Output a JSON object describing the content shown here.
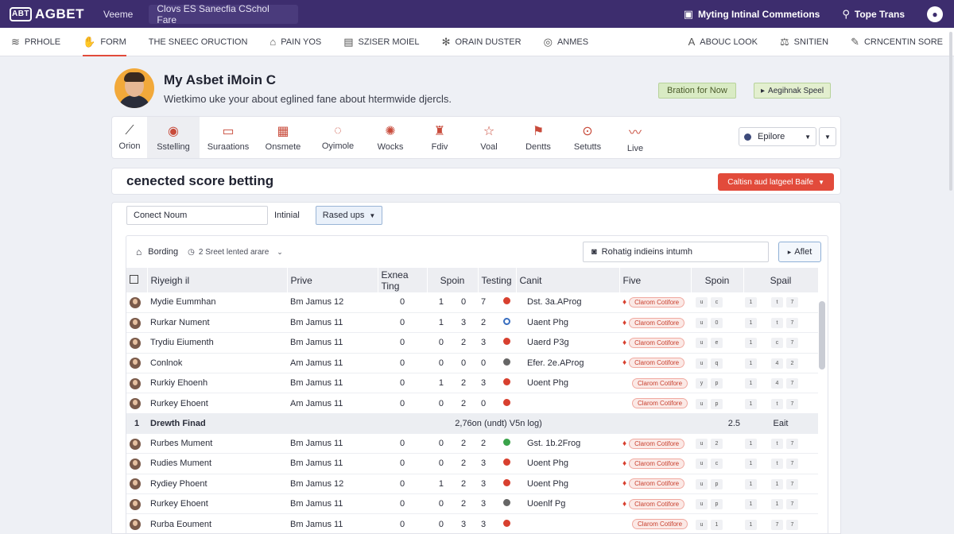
{
  "topbar": {
    "logo": "AGBET",
    "logo_badge": "ABT",
    "link": "Veeme",
    "search_text": "Clovs ES Sanecfia CSchol Fare",
    "action_label": "Myting Intinal Commetions",
    "user_label": "Tope Trans"
  },
  "nav": {
    "items": [
      {
        "icon": "wifi-icon",
        "label": "PRHOLE"
      },
      {
        "icon": "hand-icon",
        "label": "FORM"
      },
      {
        "icon": "",
        "label": "THE SNEEC ORUCTION"
      },
      {
        "icon": "building-icon",
        "label": "PAIN YOS"
      },
      {
        "icon": "calendar-icon",
        "label": "SZISER MOIEL"
      },
      {
        "icon": "gear-icon",
        "label": "ORAIN DUSTER"
      },
      {
        "icon": "globe-icon",
        "label": "ANMES"
      }
    ],
    "right_items": [
      {
        "icon": "letter-a-icon",
        "label": "ABOUC LOOK"
      },
      {
        "icon": "scale-icon",
        "label": "SNITIEN"
      },
      {
        "icon": "pen-icon",
        "label": "CRNCENTIN SORE"
      }
    ]
  },
  "profile": {
    "name": "My Asbet iMoin C",
    "subtitle": "Wietkimo uke your about eglined fane about htermwide djercls.",
    "chip1": "Bration for Now",
    "chip2": "Aegihnak Speel"
  },
  "categories": {
    "items": [
      {
        "icon": "chart-icon",
        "label": "Orion"
      },
      {
        "icon": "target-icon",
        "label": "Sstelling"
      },
      {
        "icon": "ticket-icon",
        "label": "Suraations"
      },
      {
        "icon": "calendar-icon",
        "label": "Onsmete"
      },
      {
        "icon": "soccer-icon",
        "label": "Oyimole"
      },
      {
        "icon": "star-icon",
        "label": "Wocks"
      },
      {
        "icon": "trophy-icon",
        "label": "Fdiv"
      },
      {
        "icon": "star-outline-icon",
        "label": "Voal"
      },
      {
        "icon": "flag-icon",
        "label": "Dentts"
      },
      {
        "icon": "target-icon",
        "label": "Setutts"
      },
      {
        "icon": "wave-icon",
        "label": "Live"
      }
    ],
    "explore_label": "Epilore"
  },
  "section": {
    "title": "cenected score betting",
    "button_label": "Caltisn aud latgeel Baife"
  },
  "filters": {
    "input_value": "Conect Noum",
    "label": "Intinial",
    "select_value": "Rased ups"
  },
  "toolbar": {
    "label": "Bording",
    "info": "2 Sreet lented arare",
    "search_value": "Rohatig indieins intumh",
    "button_label": "Aflet"
  },
  "table": {
    "headers": [
      "",
      "Riyeigh il",
      "Prive",
      "Exnea Ting",
      "Spoin",
      "Testing",
      "Canit",
      "Five",
      "Spoin",
      "Spail"
    ],
    "pill_text": "Clarom Cotifore",
    "rows": [
      {
        "name": "Mydie Eummhan",
        "team": "Bm Jamus 12",
        "a": "0",
        "b": "1",
        "c": "0",
        "d": "7",
        "status": "red",
        "fire": true,
        "event": "Dst. 3a.AProg",
        "m": [
          "u",
          "c",
          "1",
          "t",
          "7"
        ]
      },
      {
        "name": "Rurkar Nument",
        "team": "Bm Jamus 11",
        "a": "0",
        "b": "1",
        "c": "3",
        "d": "2",
        "status": "ring",
        "fire": true,
        "event": "Uaent Phg",
        "m": [
          "u",
          "0",
          "1",
          "t",
          "7"
        ]
      },
      {
        "name": "Trydiu Eiumenth",
        "team": "Bm Jamus 11",
        "a": "0",
        "b": "0",
        "c": "2",
        "d": "3",
        "status": "red",
        "fire": true,
        "event": "Uaerd P3g",
        "m": [
          "u",
          "e",
          "1",
          "c",
          "7"
        ]
      },
      {
        "name": "Conlnok",
        "team": "Am Jamus 11",
        "a": "0",
        "b": "0",
        "c": "0",
        "d": "0",
        "status": "gray",
        "fire": true,
        "event": "Efer. 2e.AProg",
        "m": [
          "u",
          "q",
          "1",
          "4",
          "2"
        ]
      },
      {
        "name": "Rurkiy Ehoenh",
        "team": "Bm Jamus 11",
        "a": "0",
        "b": "1",
        "c": "2",
        "d": "3",
        "status": "red",
        "fire": false,
        "event": "Uoent Phg",
        "m": [
          "y",
          "p",
          "1",
          "4",
          "7"
        ]
      },
      {
        "name": "Rurkey Ehoent",
        "team": "Am Jamus 11",
        "a": "0",
        "b": "0",
        "c": "2",
        "d": "0",
        "status": "red",
        "fire": false,
        "event": "",
        "m": [
          "u",
          "p",
          "1",
          "t",
          "7"
        ]
      }
    ],
    "group": {
      "index": "1",
      "label": "Drewth Finad",
      "summary": "2,76on (undt) V5n log)",
      "value": "2.5",
      "extra": "Eait"
    },
    "rows2": [
      {
        "name": "Rurbes Mument",
        "team": "Bm Jamus 11",
        "a": "0",
        "b": "0",
        "c": "2",
        "d": "2",
        "status": "green",
        "fire": true,
        "event": "Gst. 1b.2Frog",
        "m": [
          "u",
          "2",
          "1",
          "t",
          "7"
        ]
      },
      {
        "name": "Rudies Mument",
        "team": "Bm Jamus 11",
        "a": "0",
        "b": "0",
        "c": "2",
        "d": "3",
        "status": "red",
        "fire": true,
        "event": "Uoent Phg",
        "m": [
          "u",
          "c",
          "1",
          "t",
          "7"
        ]
      },
      {
        "name": "Rydiey Phoent",
        "team": "Bm Jamus 12",
        "a": "0",
        "b": "1",
        "c": "2",
        "d": "3",
        "status": "red",
        "fire": true,
        "event": "Uoent Phg",
        "m": [
          "u",
          "p",
          "1",
          "1",
          "7"
        ]
      },
      {
        "name": "Rurkey Ehoent",
        "team": "Bm Jamus 11",
        "a": "0",
        "b": "0",
        "c": "2",
        "d": "3",
        "status": "gray",
        "fire": true,
        "event": "Uoenlf Pg",
        "m": [
          "u",
          "p",
          "1",
          "1",
          "7"
        ]
      },
      {
        "name": "Rurba Eoument",
        "team": "Bm Jamus 11",
        "a": "0",
        "b": "0",
        "c": "3",
        "d": "3",
        "status": "red",
        "fire": false,
        "event": "",
        "m": [
          "u",
          "1",
          "1",
          "7",
          "7"
        ]
      }
    ]
  }
}
